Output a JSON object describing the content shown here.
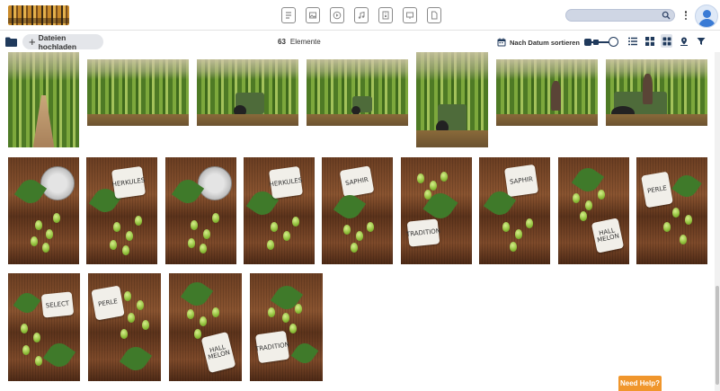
{
  "header": {
    "app_icons": [
      "document-icon",
      "image-document-icon",
      "video-icon",
      "music-icon",
      "archive-icon",
      "presentation-icon",
      "file-icon"
    ],
    "search": {
      "placeholder": "",
      "value": ""
    }
  },
  "toolbar": {
    "upload_label": "Dateien hochladen",
    "count_value": "63",
    "count_label": "Elemente",
    "sort_label": "Nach Datum sortieren"
  },
  "thumbnails": [
    {
      "kind": "field",
      "variant": "path"
    },
    {
      "kind": "field",
      "variant": "sky"
    },
    {
      "kind": "field",
      "variant": "tractor"
    },
    {
      "kind": "field",
      "variant": "tractor"
    },
    {
      "kind": "field",
      "variant": "tractor"
    },
    {
      "kind": "field",
      "variant": "person"
    },
    {
      "kind": "field",
      "variant": "person-tractor"
    },
    {
      "kind": "hop",
      "card": "",
      "coin": true
    },
    {
      "kind": "hop",
      "card": "HERKULES"
    },
    {
      "kind": "hop",
      "card": "",
      "coin": true
    },
    {
      "kind": "hop",
      "card": "HERKULES"
    },
    {
      "kind": "hop",
      "card": "SAPHIR"
    },
    {
      "kind": "hop",
      "card": "TRADITION"
    },
    {
      "kind": "hop",
      "card": "SAPHIR"
    },
    {
      "kind": "hop",
      "card": "HALL MELON"
    },
    {
      "kind": "hop",
      "card": "PERLE"
    },
    {
      "kind": "hop",
      "card": "SELECT"
    },
    {
      "kind": "hop",
      "card": "PERLE"
    },
    {
      "kind": "hop",
      "card": "HALL MELON"
    },
    {
      "kind": "hop",
      "card": "TRADITION"
    }
  ],
  "help": {
    "label": "Need Help?"
  },
  "colors": {
    "accent": "#203a5c",
    "help": "#f0962c",
    "avatar": "#3a7bd5"
  }
}
